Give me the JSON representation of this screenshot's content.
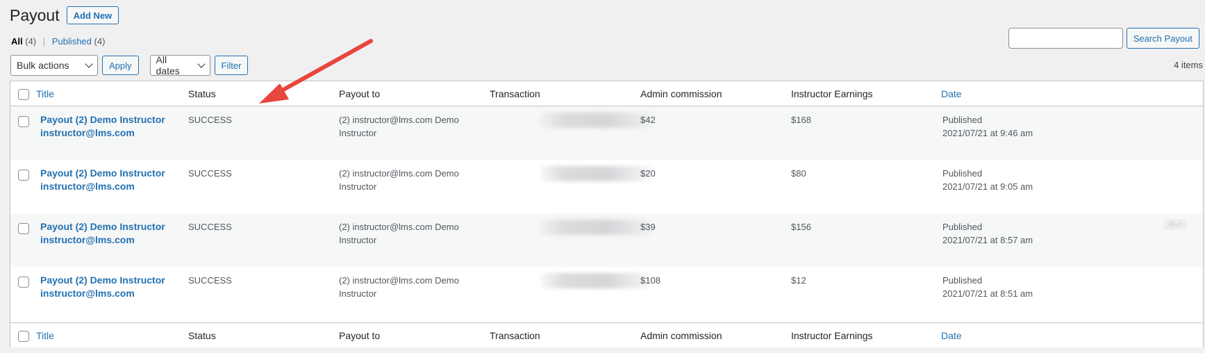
{
  "page": {
    "title": "Payout",
    "add_new": "Add New"
  },
  "views": {
    "all_label": "All",
    "all_count": "(4)",
    "separator": "|",
    "published_label": "Published",
    "published_count": "(4)"
  },
  "search": {
    "value": "",
    "button": "Search Payout"
  },
  "toolbar": {
    "bulk_actions": "Bulk actions",
    "apply": "Apply",
    "all_dates": "All dates",
    "filter": "Filter",
    "items_count": "4 items"
  },
  "table": {
    "columns": [
      "Title",
      "Status",
      "Payout to",
      "Transaction",
      "Admin commission",
      "Instructor Earnings",
      "Date"
    ],
    "rows": [
      {
        "title": "Payout (2) Demo Instructor instructor@lms.com",
        "status": "SUCCESS",
        "payout_to": "(2) instructor@lms.com Demo Instructor",
        "admin_commission": "$42",
        "instructor_earnings": "$168",
        "date_status": "Published",
        "date": "2021/07/21 at 9:46 am"
      },
      {
        "title": "Payout (2) Demo Instructor instructor@lms.com",
        "status": "SUCCESS",
        "payout_to": "(2) instructor@lms.com Demo Instructor",
        "admin_commission": "$20",
        "instructor_earnings": "$80",
        "date_status": "Published",
        "date": "2021/07/21 at 9:05 am"
      },
      {
        "title": "Payout (2) Demo Instructor instructor@lms.com",
        "status": "SUCCESS",
        "payout_to": "(2) instructor@lms.com Demo Instructor",
        "admin_commission": "$39",
        "instructor_earnings": "$156",
        "date_status": "Published",
        "date": "2021/07/21 at 8:57 am"
      },
      {
        "title": "Payout (2) Demo Instructor instructor@lms.com",
        "status": "SUCCESS",
        "payout_to": "(2) instructor@lms.com Demo Instructor",
        "admin_commission": "$108",
        "instructor_earnings": "$12",
        "date_status": "Published",
        "date": "2021/07/21 at 8:51 am"
      }
    ],
    "blur_tag": "Blur"
  },
  "annotation": {
    "arrow_color": "#e8453c"
  },
  "colors": {
    "link": "#2271b1",
    "background": "#f0f0f1"
  }
}
